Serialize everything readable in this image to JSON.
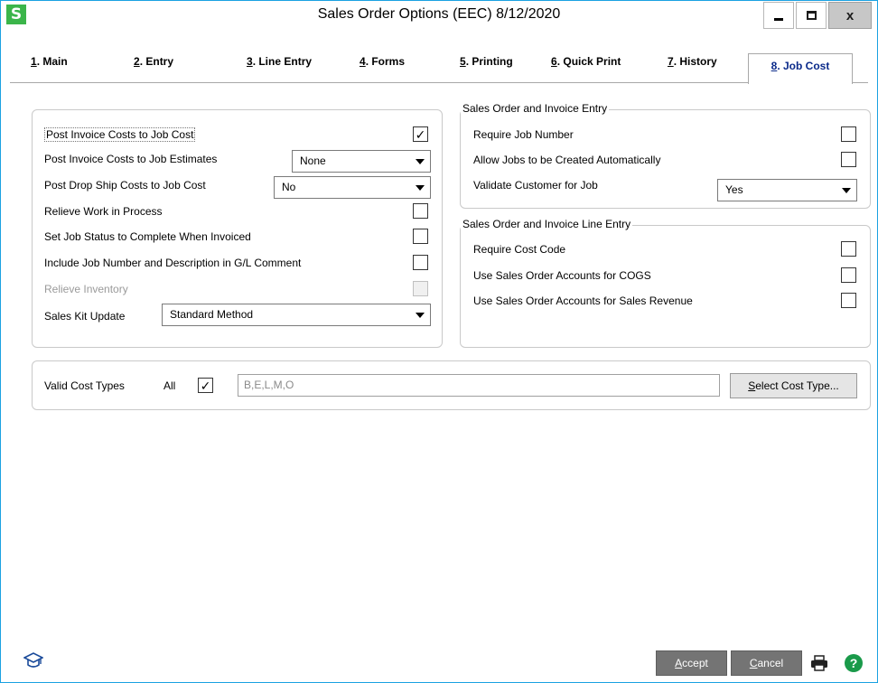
{
  "window": {
    "app_icon_letter": "S",
    "title": "Sales Order Options (EEC) 8/12/2020",
    "close_glyph": "x"
  },
  "tabs": [
    {
      "num": "1",
      "label": ". Main"
    },
    {
      "num": "2",
      "label": ". Entry"
    },
    {
      "num": "3",
      "label": ". Line Entry"
    },
    {
      "num": "4",
      "label": ". Forms"
    },
    {
      "num": "5",
      "label": ". Printing"
    },
    {
      "num": "6",
      "label": ". Quick Print"
    },
    {
      "num": "7",
      "label": ". History"
    },
    {
      "num": "8",
      "label": ". Job Cost"
    }
  ],
  "left_panel": {
    "post_invoice_costs": {
      "label": "Post Invoice Costs to Job Cost",
      "checked": true
    },
    "post_invoice_estimates": {
      "label": "Post Invoice Costs to Job Estimates",
      "value": "None"
    },
    "post_drop_ship": {
      "label": "Post Drop Ship Costs to Job Cost",
      "value": "No"
    },
    "relieve_wip": {
      "label": "Relieve Work in Process",
      "checked": false
    },
    "set_job_status": {
      "label": "Set Job Status to Complete When Invoiced",
      "checked": false
    },
    "include_job_number": {
      "label": "Include Job Number and Description in G/L Comment",
      "checked": false
    },
    "relieve_inventory": {
      "label": "Relieve Inventory",
      "checked": false,
      "disabled": true
    },
    "sales_kit_update": {
      "label": "Sales Kit Update",
      "value": "Standard Method"
    }
  },
  "right_top_panel": {
    "legend": "Sales Order and Invoice Entry",
    "require_job_number": {
      "label": "Require Job Number",
      "checked": false
    },
    "allow_jobs_auto": {
      "label": "Allow Jobs to be Created Automatically",
      "checked": false
    },
    "validate_customer": {
      "label": "Validate Customer for Job",
      "value": "Yes"
    }
  },
  "right_bottom_panel": {
    "legend": "Sales Order and Invoice Line Entry",
    "require_cost_code": {
      "label": "Require Cost Code",
      "checked": false
    },
    "use_so_cogs": {
      "label": "Use Sales Order Accounts for COGS",
      "checked": false
    },
    "use_so_revenue": {
      "label": "Use Sales Order Accounts for Sales Revenue",
      "checked": false
    }
  },
  "cost_types": {
    "label": "Valid Cost Types",
    "all_label": "All",
    "all_checked": true,
    "value": "B,E,L,M,O",
    "select_button_underlined": "S",
    "select_button_rest": "elect Cost Type..."
  },
  "footer": {
    "accept_underlined": "A",
    "accept_rest": "ccept",
    "cancel_underlined": "C",
    "cancel_rest": "ancel"
  },
  "icons": {
    "app": "app-s-icon",
    "minimize": "minimize-icon",
    "maximize": "maximize-icon",
    "close": "close-icon",
    "help_cap": "graduation-cap-icon",
    "printer": "printer-icon",
    "help": "help-icon"
  },
  "colors": {
    "app_icon": "#3bb54a",
    "window_border": "#1ba1e2",
    "active_tab_text": "#0a2a8a",
    "help_icon": "#1a9a4a",
    "dark_button": "#747474"
  }
}
